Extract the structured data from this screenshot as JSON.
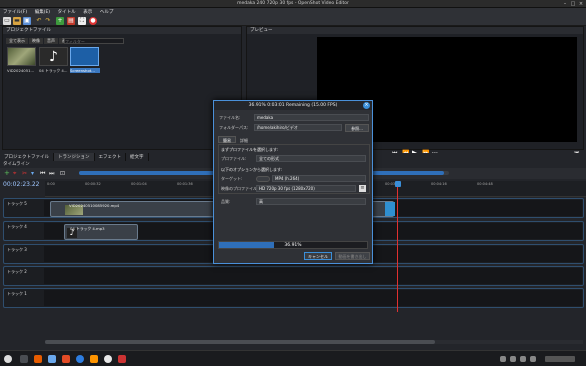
{
  "window": {
    "title": "medaka 240 720p 30 fps - OpenShot Video Editor"
  },
  "menu": [
    "ファイル(F)",
    "編集(E)",
    "タイトル",
    "表示",
    "ヘルプ"
  ],
  "project_files": {
    "header": "プロジェクトファイル",
    "filters": [
      "全て表示",
      "映像",
      "音声",
      "画像"
    ],
    "filter_placeholder": "フィルター",
    "files": [
      {
        "name": "VID2024051...",
        "kind": "video"
      },
      {
        "name": "04 トラック 4...",
        "kind": "audio"
      },
      {
        "name": "Screenshot...",
        "kind": "image"
      }
    ]
  },
  "preview": {
    "header": "プレビュー"
  },
  "bottom_tabs": [
    "プロジェクトファイル",
    "トランジション",
    "エフェクト",
    "絵文字"
  ],
  "timeline": {
    "header": "タイムライン",
    "timecode": "00:02:23.22",
    "ruler_labels": [
      "0:00",
      "00:00:32",
      "00:01:04",
      "00:01:36",
      "00:02:08",
      "00:02:40",
      "00:03:12",
      "00:03:44",
      "00:04:16",
      "00:04:48"
    ],
    "tracks": [
      {
        "name": "トラック 5",
        "clip": "VID20240510085920.mp4"
      },
      {
        "name": "トラック 4",
        "clip": "04 トラック 4.mp3"
      },
      {
        "name": "トラック 3",
        "clip": ""
      },
      {
        "name": "トラック 2",
        "clip": ""
      },
      {
        "name": "トラック 1",
        "clip": ""
      }
    ]
  },
  "dialog": {
    "title": "36.91% 0:03:01 Remaining (15.00 FPS)",
    "filename_label": "ファイル名:",
    "filename_value": "medaka",
    "folder_label": "フォルダーパス:",
    "folder_value": "/home/akihiro/ビデオ",
    "browse": "参照...",
    "tabs": [
      "簡易",
      "詳細"
    ],
    "section1": "まずプロファイルを選択します:",
    "profile_label": "プロファイル:",
    "profile_value": "全ての形式",
    "section2": "以下のオプションから選択します:",
    "target_label": "ターゲット:",
    "target_value": "MP4 (h.264)",
    "video_profile_label": "映像のプロファイル:",
    "video_profile_value": "HD 720p 30 fps (1280x720)",
    "quality_label": "品質:",
    "quality_value": "高",
    "progress_percent": 36.91,
    "progress_text": "36.91%",
    "cancel": "キャンセル",
    "export": "動画を書き出し"
  },
  "colors": {
    "accent": "#3b8fd9",
    "playhead": "#e03030"
  }
}
